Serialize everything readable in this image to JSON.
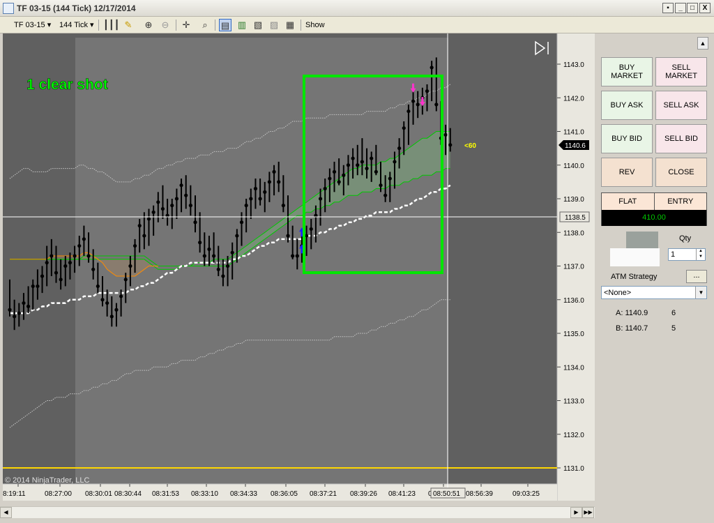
{
  "window": {
    "title": "TF 03-15 (144 Tick)  12/17/2014",
    "minimize": "_",
    "maximize": "□",
    "close": "X",
    "pin": "▪"
  },
  "toolbar": {
    "instrument": "TF 03-15",
    "interval": "144 Tick",
    "show_label": "Show"
  },
  "chart": {
    "annotation": "1 clear shot",
    "copyright": "© 2014 NinjaTrader, LLC",
    "signal_label": "<60",
    "price_axis": [
      "1143.0",
      "1142.0",
      "1141.0",
      "1140.0",
      "1139.0",
      "1138.0",
      "1137.0",
      "1136.0",
      "1135.0",
      "1134.0",
      "1133.0",
      "1132.0",
      "1131.0"
    ],
    "last_price": "1140.6",
    "crosshair_price": "1138.5",
    "time_axis": [
      "8:19:11",
      "08:27:00",
      "08:30:01",
      "08:30:44",
      "08:31:53",
      "08:33:10",
      "08:34:33",
      "08:36:05",
      "08:37:21",
      "08:39:26",
      "08:41:23",
      "08:50:51",
      "08:56:39",
      "09:03:25"
    ],
    "crosshair_time": "08:50:51",
    "colors": {
      "background": "#606060",
      "session": "#757575",
      "box": "#00e600",
      "ema": "#ffffff",
      "band": "#c8c8c8",
      "orange": "#ff8c00",
      "green": "#00c800",
      "yellow": "#ffd700",
      "buy_arrow": "#2020ff",
      "sell_arrow": "#ff33cc"
    }
  },
  "chart_data": {
    "type": "candlestick",
    "ylim": [
      1130.6,
      1143.9
    ],
    "bars": [
      [
        1136.1,
        1136.6,
        1135.5,
        1135.7
      ],
      [
        1135.7,
        1136.0,
        1135.1,
        1135.5
      ],
      [
        1135.5,
        1135.9,
        1135.2,
        1135.6
      ],
      [
        1135.6,
        1136.2,
        1135.4,
        1135.9
      ],
      [
        1135.9,
        1136.4,
        1135.6,
        1135.8
      ],
      [
        1135.8,
        1136.6,
        1135.7,
        1136.4
      ],
      [
        1136.4,
        1136.9,
        1136.0,
        1136.4
      ],
      [
        1136.4,
        1137.0,
        1136.2,
        1136.7
      ],
      [
        1136.7,
        1137.6,
        1136.4,
        1137.1
      ],
      [
        1137.1,
        1137.8,
        1136.7,
        1137.3
      ],
      [
        1137.3,
        1137.6,
        1136.5,
        1136.8
      ],
      [
        1136.8,
        1137.2,
        1136.3,
        1136.6
      ],
      [
        1136.6,
        1137.3,
        1136.4,
        1137.0
      ],
      [
        1137.0,
        1137.4,
        1136.6,
        1137.1
      ],
      [
        1137.1,
        1137.6,
        1136.8,
        1137.3
      ],
      [
        1137.3,
        1137.9,
        1137.0,
        1137.6
      ],
      [
        1137.6,
        1138.2,
        1137.3,
        1137.8
      ],
      [
        1137.8,
        1138.0,
        1137.1,
        1137.3
      ],
      [
        1137.3,
        1137.5,
        1136.6,
        1136.9
      ],
      [
        1136.9,
        1137.1,
        1136.2,
        1136.4
      ],
      [
        1136.4,
        1136.7,
        1135.8,
        1136.0
      ],
      [
        1136.0,
        1136.3,
        1135.5,
        1135.9
      ],
      [
        1135.9,
        1136.1,
        1135.2,
        1135.5
      ],
      [
        1135.5,
        1135.9,
        1135.2,
        1135.7
      ],
      [
        1135.7,
        1136.3,
        1135.5,
        1136.1
      ],
      [
        1136.1,
        1136.8,
        1135.9,
        1136.6
      ],
      [
        1136.6,
        1137.3,
        1136.4,
        1137.0
      ],
      [
        1137.0,
        1137.8,
        1136.8,
        1137.6
      ],
      [
        1137.6,
        1138.4,
        1137.4,
        1138.2
      ],
      [
        1138.2,
        1138.6,
        1137.5,
        1137.9
      ],
      [
        1137.9,
        1138.7,
        1137.6,
        1138.4
      ],
      [
        1138.4,
        1138.8,
        1137.9,
        1138.6
      ],
      [
        1138.6,
        1139.2,
        1138.3,
        1138.9
      ],
      [
        1138.9,
        1139.4,
        1138.4,
        1138.7
      ],
      [
        1138.7,
        1139.0,
        1138.2,
        1138.5
      ],
      [
        1138.5,
        1139.0,
        1138.1,
        1138.8
      ],
      [
        1138.8,
        1139.3,
        1138.4,
        1139.0
      ],
      [
        1139.0,
        1139.6,
        1138.6,
        1139.4
      ],
      [
        1139.4,
        1139.7,
        1138.7,
        1139.1
      ],
      [
        1139.1,
        1139.4,
        1138.5,
        1138.8
      ],
      [
        1138.8,
        1139.1,
        1138.0,
        1138.3
      ],
      [
        1138.3,
        1138.6,
        1137.4,
        1137.7
      ],
      [
        1137.7,
        1138.0,
        1137.0,
        1137.3
      ],
      [
        1137.3,
        1137.9,
        1137.0,
        1137.5
      ],
      [
        1137.5,
        1138.0,
        1137.1,
        1137.3
      ],
      [
        1137.3,
        1137.6,
        1136.7,
        1136.9
      ],
      [
        1136.9,
        1137.2,
        1136.4,
        1136.7
      ],
      [
        1136.7,
        1137.3,
        1136.4,
        1137.0
      ],
      [
        1137.0,
        1137.7,
        1136.6,
        1137.4
      ],
      [
        1137.4,
        1138.1,
        1137.1,
        1137.9
      ],
      [
        1137.9,
        1138.6,
        1137.6,
        1138.3
      ],
      [
        1138.3,
        1139.0,
        1138.0,
        1138.8
      ],
      [
        1138.8,
        1139.3,
        1138.4,
        1139.0
      ],
      [
        1139.0,
        1139.6,
        1138.7,
        1139.3
      ],
      [
        1139.3,
        1139.6,
        1138.8,
        1139.0
      ],
      [
        1139.0,
        1139.5,
        1138.6,
        1139.2
      ],
      [
        1139.2,
        1139.8,
        1138.9,
        1139.5
      ],
      [
        1139.5,
        1140.0,
        1139.1,
        1139.8
      ],
      [
        1139.8,
        1140.1,
        1139.2,
        1139.5
      ],
      [
        1139.5,
        1139.7,
        1138.6,
        1138.8
      ],
      [
        1138.8,
        1139.1,
        1137.7,
        1137.9
      ],
      [
        1137.9,
        1138.2,
        1137.2,
        1137.3
      ],
      [
        1137.3,
        1137.8,
        1136.9,
        1137.3
      ],
      [
        1137.3,
        1137.9,
        1137.1,
        1137.6
      ],
      [
        1137.6,
        1138.2,
        1137.3,
        1137.9
      ],
      [
        1137.9,
        1138.4,
        1137.5,
        1138.1
      ],
      [
        1138.1,
        1138.8,
        1137.7,
        1138.5
      ],
      [
        1138.5,
        1139.3,
        1138.2,
        1139.0
      ],
      [
        1139.0,
        1139.6,
        1138.6,
        1139.3
      ],
      [
        1139.3,
        1139.9,
        1138.9,
        1139.6
      ],
      [
        1139.6,
        1140.1,
        1139.2,
        1139.8
      ],
      [
        1139.8,
        1140.2,
        1139.4,
        1139.5
      ],
      [
        1139.5,
        1140.0,
        1139.1,
        1139.7
      ],
      [
        1139.7,
        1140.3,
        1139.4,
        1140.0
      ],
      [
        1140.0,
        1140.5,
        1139.6,
        1140.2
      ],
      [
        1140.2,
        1140.6,
        1139.7,
        1140.0
      ],
      [
        1140.0,
        1140.8,
        1139.7,
        1140.1
      ],
      [
        1140.1,
        1140.5,
        1139.6,
        1139.9
      ],
      [
        1139.9,
        1140.4,
        1139.5,
        1140.2
      ],
      [
        1140.2,
        1140.6,
        1139.7,
        1139.8
      ],
      [
        1139.8,
        1140.1,
        1139.2,
        1139.4
      ],
      [
        1139.4,
        1139.7,
        1138.9,
        1139.1
      ],
      [
        1139.1,
        1139.8,
        1138.9,
        1139.6
      ],
      [
        1139.6,
        1140.4,
        1139.3,
        1140.1
      ],
      [
        1140.1,
        1140.8,
        1139.9,
        1140.5
      ],
      [
        1140.5,
        1141.3,
        1140.3,
        1141.1
      ],
      [
        1141.1,
        1141.8,
        1140.6,
        1141.6
      ],
      [
        1141.6,
        1142.2,
        1141.2,
        1141.9
      ],
      [
        1141.9,
        1142.2,
        1141.4,
        1141.8
      ],
      [
        1141.8,
        1142.3,
        1141.5,
        1142.0
      ],
      [
        1142.0,
        1142.4,
        1141.6,
        1142.2
      ],
      [
        1142.2,
        1143.1,
        1141.9,
        1142.9
      ],
      [
        1142.9,
        1143.2,
        1141.6,
        1141.8
      ],
      [
        1141.8,
        1141.9,
        1140.6,
        1140.8
      ],
      [
        1140.8,
        1141.2,
        1140.3,
        1140.9
      ],
      [
        1140.9,
        1141.1,
        1140.4,
        1140.6
      ]
    ],
    "series": [
      {
        "values": [
          1135.6,
          1135.6,
          1135.6,
          1135.6,
          1135.6,
          1135.7,
          1135.7,
          1135.8,
          1135.8,
          1135.9,
          1135.9,
          1135.9,
          1135.9,
          1136.0,
          1136.0,
          1136.0,
          1136.1,
          1136.1,
          1136.1,
          1136.2,
          1136.2,
          1136.2,
          1136.2,
          1136.2,
          1136.2,
          1136.2,
          1136.3,
          1136.3,
          1136.4,
          1136.4,
          1136.5,
          1136.5,
          1136.6,
          1136.7,
          1136.8,
          1136.8,
          1136.9,
          1137.0,
          1137.0,
          1137.1,
          1137.1,
          1137.1,
          1137.1,
          1137.1,
          1137.1,
          1137.1,
          1137.1,
          1137.1,
          1137.2,
          1137.2,
          1137.3,
          1137.3,
          1137.4,
          1137.5,
          1137.6,
          1137.6,
          1137.7,
          1137.7,
          1137.8,
          1137.8,
          1137.8,
          1137.8,
          1137.8,
          1137.8,
          1137.9,
          1137.9,
          1137.9,
          1138.0,
          1138.0,
          1138.1,
          1138.1,
          1138.2,
          1138.2,
          1138.3,
          1138.3,
          1138.4,
          1138.4,
          1138.5,
          1138.5,
          1138.6,
          1138.6,
          1138.6,
          1138.6,
          1138.7,
          1138.7,
          1138.8,
          1138.8,
          1138.9,
          1139.0,
          1139.0,
          1139.1,
          1139.2,
          1139.2,
          1139.3,
          1139.3,
          1139.4
        ]
      },
      {
        "values": [
          1139.6,
          1139.7,
          1139.8,
          1139.9,
          1139.9,
          1139.8,
          1139.8,
          1139.8,
          1139.8,
          1139.9,
          1139.9,
          1139.9,
          1139.9,
          1139.9,
          1139.9,
          1140.0,
          1140.0,
          1139.9,
          1139.9,
          1139.8,
          1139.8,
          1139.7,
          1139.6,
          1139.5,
          1139.5,
          1139.5,
          1139.5,
          1139.6,
          1139.6,
          1139.7,
          1139.7,
          1139.8,
          1139.9,
          1139.9,
          1140.0,
          1140.0,
          1140.1,
          1140.1,
          1140.2,
          1140.2,
          1140.2,
          1140.3,
          1140.3,
          1140.3,
          1140.4,
          1140.4,
          1140.4,
          1140.5,
          1140.5,
          1140.5,
          1140.6,
          1140.7,
          1140.7,
          1140.8,
          1140.8,
          1140.9,
          1141.0,
          1141.0,
          1141.1,
          1141.1,
          1141.2,
          1141.3,
          1141.3,
          1141.3,
          1141.4,
          1141.4,
          1141.4,
          1141.4,
          1141.4,
          1141.5,
          1141.5,
          1141.5,
          1141.5,
          1141.5,
          1141.5,
          1141.5,
          1141.5,
          1141.6,
          1141.6,
          1141.6,
          1141.6,
          1141.6,
          1141.7,
          1141.7,
          1141.8,
          1141.8,
          1141.9,
          1141.9,
          1142.0,
          1142.0,
          1142.1,
          1142.2,
          1142.2,
          1142.3,
          1142.3,
          1142.4
        ]
      },
      {
        "values": [
          1132.2,
          1132.3,
          1132.4,
          1132.5,
          1132.6,
          1132.7,
          1132.8,
          1132.9,
          1133.0,
          1133.0,
          1133.1,
          1133.1,
          1133.1,
          1133.2,
          1133.2,
          1133.2,
          1133.3,
          1133.3,
          1133.4,
          1133.4,
          1133.5,
          1133.5,
          1133.6,
          1133.6,
          1133.7,
          1133.8,
          1133.8,
          1133.9,
          1133.9,
          1133.9,
          1133.9,
          1134.0,
          1134.0,
          1134.0,
          1134.0,
          1134.1,
          1134.1,
          1134.2,
          1134.2,
          1134.2,
          1134.2,
          1134.3,
          1134.3,
          1134.4,
          1134.4,
          1134.5,
          1134.5,
          1134.6,
          1134.6,
          1134.7,
          1134.7,
          1134.8,
          1134.8,
          1134.8,
          1134.8,
          1134.8,
          1134.8,
          1134.8,
          1134.8,
          1134.8,
          1134.8,
          1134.8,
          1134.8,
          1134.8,
          1134.8,
          1134.8,
          1134.8,
          1134.8,
          1134.8,
          1134.8,
          1134.9,
          1134.9,
          1134.9,
          1134.9,
          1134.9,
          1135.0,
          1135.0,
          1135.0,
          1135.1,
          1135.1,
          1135.2,
          1135.2,
          1135.3,
          1135.3,
          1135.4,
          1135.4,
          1135.5,
          1135.5,
          1135.6,
          1135.7,
          1135.7,
          1135.8,
          1135.9,
          1136.0,
          1136.0,
          1136.0
        ]
      },
      {
        "values": [
          1137.2,
          1137.2,
          1137.2,
          1137.2,
          1137.2,
          1137.2,
          1137.2,
          1137.2,
          1137.2,
          1137.2,
          1137.2,
          1137.2,
          1137.2,
          1137.2,
          1137.2,
          1137.2,
          1137.3,
          1137.3,
          1137.3,
          1137.3,
          1137.3,
          1137.3,
          1137.3,
          1137.3,
          1137.3,
          1137.3,
          1137.3,
          1137.3,
          1137.3,
          1137.3,
          1137.2,
          1137.1,
          1137.0,
          1137.0,
          1137.0,
          1137.0,
          1137.0,
          1137.0,
          1137.0,
          1137.0,
          1137.1,
          1137.1,
          1137.1,
          1137.1,
          1137.2,
          1137.2,
          1137.2,
          1137.2,
          1137.3,
          1137.4,
          1137.5,
          1137.6,
          1137.7,
          1137.8,
          1137.9,
          1138.0,
          1138.1,
          1138.2,
          1138.3,
          1138.4,
          1138.5,
          1138.6,
          1138.7,
          1138.8,
          1138.9,
          1139.0,
          1139.1,
          1139.2,
          1139.3,
          1139.4,
          1139.5,
          1139.6,
          1139.7,
          1139.8,
          1139.9,
          1139.9,
          1140.0,
          1140.0,
          1140.0,
          1140.0,
          1140.1,
          1140.1,
          1140.2,
          1140.2,
          1140.3,
          1140.4,
          1140.5,
          1140.6,
          1140.7,
          1140.8,
          1140.8,
          1140.9,
          1141.0,
          1141.0,
          1141.0,
          1141.0
        ]
      },
      {
        "values": [
          1137.2,
          1137.2,
          1137.2,
          1137.2,
          1137.2,
          1137.2,
          1137.2,
          1137.2,
          1137.2,
          1137.2,
          1137.2,
          1137.2,
          1137.2,
          1137.2,
          1137.2,
          1137.2,
          1137.2,
          1137.2,
          1137.2,
          1137.2,
          1137.2,
          1137.2,
          1137.2,
          1137.2,
          1137.2,
          1137.2,
          1137.2,
          1137.2,
          1137.2,
          1137.2,
          1137.1,
          1137.0,
          1136.9,
          1136.9,
          1136.9,
          1136.9,
          1136.9,
          1137.0,
          1137.0,
          1137.0,
          1137.0,
          1137.0,
          1137.0,
          1137.0,
          1137.0,
          1137.0,
          1137.0,
          1137.0,
          1137.1,
          1137.2,
          1137.3,
          1137.4,
          1137.5,
          1137.6,
          1137.7,
          1137.8,
          1137.9,
          1138.0,
          1138.1,
          1138.2,
          1138.3,
          1138.4,
          1138.5,
          1138.5,
          1138.6,
          1138.6,
          1138.7,
          1138.7,
          1138.8,
          1138.8,
          1138.9,
          1138.9,
          1139.0,
          1139.1,
          1139.1,
          1139.1,
          1139.2,
          1139.2,
          1139.2,
          1139.3,
          1139.3,
          1139.3,
          1139.4,
          1139.4,
          1139.4,
          1139.5,
          1139.5,
          1139.6,
          1139.6,
          1139.7,
          1139.7,
          1139.7,
          1139.8,
          1139.8,
          1139.9,
          1139.9
        ]
      },
      {
        "values": [
          1137.2,
          1137.2,
          1137.2,
          1137.2,
          1137.2,
          1137.2,
          1137.2,
          1137.2,
          1137.2,
          1137.3,
          1137.3,
          1137.3,
          1137.3,
          1137.3,
          1137.3,
          1137.3,
          1137.4,
          1137.4,
          1137.3,
          1137.2,
          1137.1,
          1136.9,
          1136.8,
          1136.7,
          1136.7,
          1136.7,
          1136.7,
          1136.7,
          1136.8,
          1136.9,
          1137.0,
          1137.0,
          1137.0
        ]
      }
    ],
    "markers": [
      {
        "type": "buy",
        "bar": 63,
        "price": 1137.5
      },
      {
        "type": "buy",
        "bar": 63,
        "price": 1138.0
      },
      {
        "type": "sell",
        "bar": 87,
        "price": 1142.3
      },
      {
        "type": "sell",
        "bar": 89,
        "price": 1141.9
      }
    ]
  },
  "panel": {
    "buy_market": "BUY\nMARKET",
    "sell_market": "SELL\nMARKET",
    "buy_ask": "BUY ASK",
    "sell_ask": "SELL ASK",
    "buy_bid": "BUY BID",
    "sell_bid": "SELL BID",
    "rev": "REV",
    "close": "CLOSE",
    "position": "FLAT",
    "entry": "ENTRY",
    "pnl": "410.00",
    "qty_label": "Qty",
    "qty_value": "1",
    "atm_label": "ATM Strategy",
    "atm_more": "...",
    "atm_value": "<None>",
    "ask_label": "A: 1140.9",
    "ask_size": "6",
    "bid_label": "B: 1140.7",
    "bid_size": "5"
  }
}
